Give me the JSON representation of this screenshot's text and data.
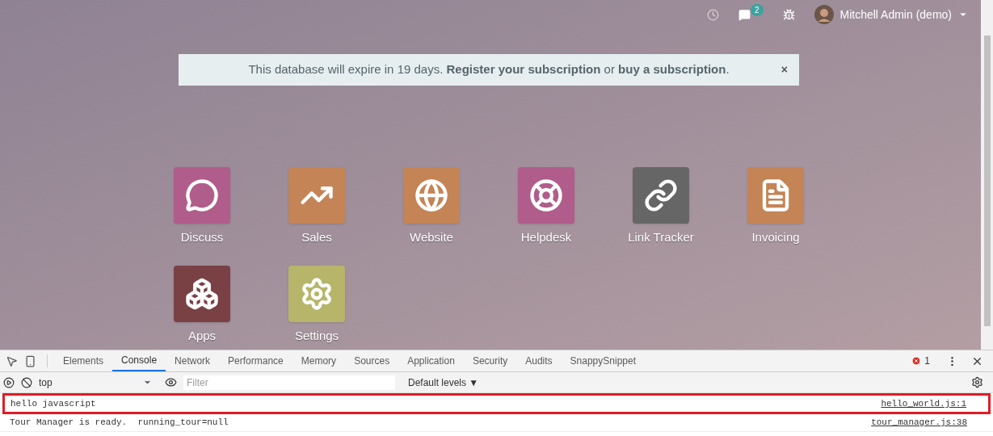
{
  "navbar": {
    "messages_badge": "2",
    "user": "Mitchell Admin (demo)"
  },
  "notice": {
    "text": "This database will expire in 19 days. **Register your subscription** or **buy a subscription**.",
    "close": "×"
  },
  "apps": [
    {
      "label": "Discuss",
      "kind": "chat",
      "color": "#b05d8b"
    },
    {
      "label": "Sales",
      "kind": "chart",
      "color": "#c48455"
    },
    {
      "label": "Website",
      "kind": "globe",
      "color": "#c48455"
    },
    {
      "label": "Helpdesk",
      "kind": "lifebuoy",
      "color": "#b05d8b"
    },
    {
      "label": "Link Tracker",
      "kind": "link",
      "color": "#666666"
    },
    {
      "label": "Invoicing",
      "kind": "invoice",
      "color": "#c48455"
    },
    {
      "label": "Apps",
      "kind": "cubes",
      "color": "#7a4145"
    },
    {
      "label": "Settings",
      "kind": "gear",
      "color": "#b7b56a"
    }
  ],
  "devtools": {
    "tabs": [
      {
        "label": "Elements",
        "selected": false
      },
      {
        "label": "Console",
        "selected": true
      },
      {
        "label": "Network",
        "selected": false
      },
      {
        "label": "Performance",
        "selected": false
      },
      {
        "label": "Memory",
        "selected": false
      },
      {
        "label": "Sources",
        "selected": false
      },
      {
        "label": "Application",
        "selected": false
      },
      {
        "label": "Security",
        "selected": false
      },
      {
        "label": "Audits",
        "selected": false
      },
      {
        "label": "SnappySnippet",
        "selected": false
      }
    ],
    "error_count": "1",
    "context": "top",
    "filter": {
      "placeholder": "Filter"
    },
    "levels": "Default levels ▼",
    "messages": [
      {
        "text": "hello javascript",
        "source": "hello_world.js:1",
        "highlighted": true
      },
      {
        "text": "Tour Manager is ready.  running_tour=null",
        "source": "tour_manager.js:38",
        "highlighted": false
      }
    ]
  }
}
